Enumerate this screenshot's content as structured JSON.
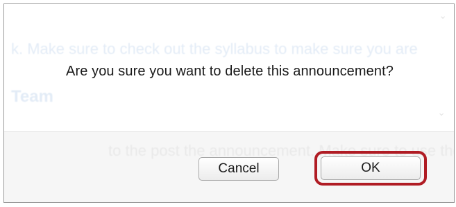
{
  "dialog": {
    "message": "Are you sure you want to delete this announcement?",
    "buttons": {
      "cancel_label": "Cancel",
      "ok_label": "OK"
    },
    "highlight_color": "#b01c24"
  },
  "background": {
    "line1": "k. Make sure to check out the syllabus to make sure you are",
    "line2": "Team",
    "line3": "to the post the announcement. Make sure to use the"
  }
}
